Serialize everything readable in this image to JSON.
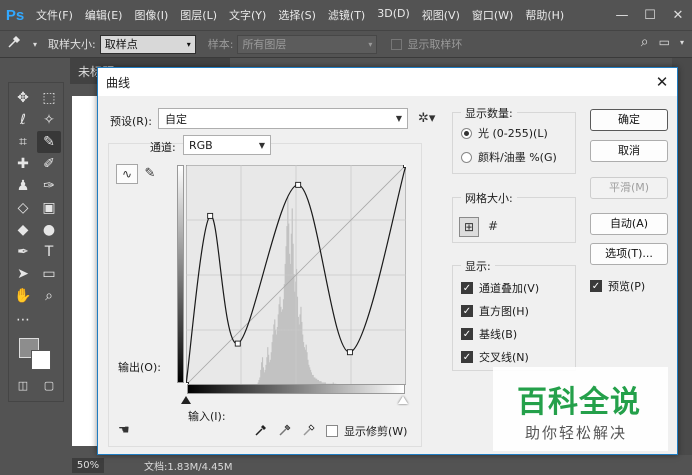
{
  "app": {
    "logo": "Ps"
  },
  "menubar": {
    "items": [
      "文件(F)",
      "编辑(E)",
      "图像(I)",
      "图层(L)",
      "文字(Y)",
      "选择(S)",
      "滤镜(T)",
      "3D(D)",
      "视图(V)",
      "窗口(W)",
      "帮助(H)"
    ]
  },
  "window_controls": {
    "minimize": "—",
    "restore": "☐",
    "close": "✕"
  },
  "options_bar": {
    "sample_size_label": "取样大小:",
    "sample_size_value": "取样点",
    "sample_label": "样本:",
    "sample_value": "所有图层",
    "show_ring_label": "显示取样环"
  },
  "doc": {
    "tab_title": "未标题",
    "zoom": "50%",
    "status": "文档:1.83M/4.45M"
  },
  "dialog": {
    "title": "曲线",
    "close": "✕",
    "preset_label": "预设(R):",
    "preset_value": "自定",
    "channel_label": "通道:",
    "channel_value": "RGB",
    "output_label": "输出(O):",
    "input_label": "输入(I):",
    "show_clipping_label": "显示修剪(W)",
    "show_amount": {
      "legend": "显示数量:",
      "light": "光 (0-255)(L)",
      "pigment": "颜料/油墨 %(G)",
      "selected": "light"
    },
    "grid_size": {
      "legend": "网格大小:"
    },
    "show": {
      "legend": "显示:",
      "channel_overlays": "通道叠加(V)",
      "histogram": "直方图(H)",
      "baseline": "基线(B)",
      "intersection": "交叉线(N)"
    },
    "buttons": {
      "ok": "确定",
      "cancel": "取消",
      "smooth": "平滑(M)",
      "auto": "自动(A)",
      "options": "选项(T)..."
    },
    "preview_label": "预览(P)"
  },
  "watermark": {
    "title": "百科全说",
    "subtitle": "助你轻松解决"
  },
  "chart_data": {
    "type": "line",
    "title": "",
    "xlabel": "输入(I):",
    "ylabel": "输出(O):",
    "xlim": [
      0,
      255
    ],
    "ylim": [
      0,
      255
    ],
    "grid": true,
    "series": [
      {
        "values_x": [
          0,
          28,
          60,
          130,
          190,
          255
        ],
        "values_y": [
          0,
          196,
          48,
          232,
          38,
          255
        ]
      }
    ],
    "baseline": [
      [
        0,
        0
      ],
      [
        255,
        255
      ]
    ],
    "histogram": [
      0,
      0,
      0,
      0,
      0,
      0,
      0,
      0,
      0,
      0,
      0,
      0,
      0,
      0,
      0,
      0,
      0,
      0,
      0,
      0,
      0,
      0,
      0,
      0,
      0,
      0,
      0,
      0,
      0,
      0,
      0,
      0,
      0,
      0,
      0,
      0,
      0,
      0,
      0,
      0,
      0,
      0,
      0,
      0,
      0,
      0,
      0,
      0,
      0,
      0,
      0,
      0,
      0,
      0,
      0,
      0,
      0,
      0,
      0,
      0,
      0,
      0,
      0,
      0,
      0,
      0,
      0,
      0,
      0,
      0,
      0,
      0,
      0,
      0,
      0,
      0,
      0,
      0,
      0,
      0,
      0,
      0,
      2,
      4,
      6,
      12,
      18,
      22,
      14,
      10,
      12,
      16,
      22,
      30,
      24,
      18,
      20,
      26,
      34,
      40,
      48,
      52,
      44,
      40,
      46,
      56,
      64,
      70,
      62,
      58,
      60,
      68,
      80,
      96,
      110,
      126,
      150,
      128,
      104,
      96,
      120,
      140,
      112,
      88,
      74,
      82,
      92,
      70,
      54,
      48,
      56,
      62,
      50,
      40,
      34,
      30,
      28,
      32,
      26,
      20,
      16,
      14,
      12,
      10,
      8,
      8,
      6,
      6,
      5,
      5,
      4,
      4,
      3,
      3,
      3,
      2,
      2,
      2,
      2,
      2,
      1,
      1,
      1,
      1,
      1,
      1,
      1,
      1,
      2,
      1,
      1,
      1,
      0,
      0,
      0,
      0,
      0,
      0,
      0,
      0,
      0,
      0,
      0,
      0,
      0,
      0,
      0,
      0,
      0,
      0,
      0,
      0,
      0,
      0,
      0,
      0,
      0,
      0,
      0,
      0,
      0,
      0,
      0,
      0,
      0,
      0,
      0,
      0,
      0,
      0,
      0,
      0,
      0,
      0,
      0,
      0,
      0,
      0,
      0,
      0,
      0,
      0,
      0,
      0,
      0,
      0,
      0,
      0,
      0,
      0,
      0,
      0,
      0,
      0,
      0,
      0,
      0,
      0,
      0,
      0,
      0,
      0,
      0,
      0,
      0,
      0,
      0,
      0,
      0,
      0,
      0,
      0
    ]
  },
  "colors": {
    "ps_chrome": "#535353",
    "dialog_bg": "#f0f0f0",
    "graph_bg": "#e8e8e8",
    "curve": "#1a1a1a",
    "watermark_green": "#24a04a",
    "accent_border": "#1f7cc1"
  },
  "icons": {
    "eyedropper": "eyedropper-icon",
    "gear": "gear-icon",
    "curve_tool": "curve-point-icon",
    "pencil": "pencil-icon"
  }
}
